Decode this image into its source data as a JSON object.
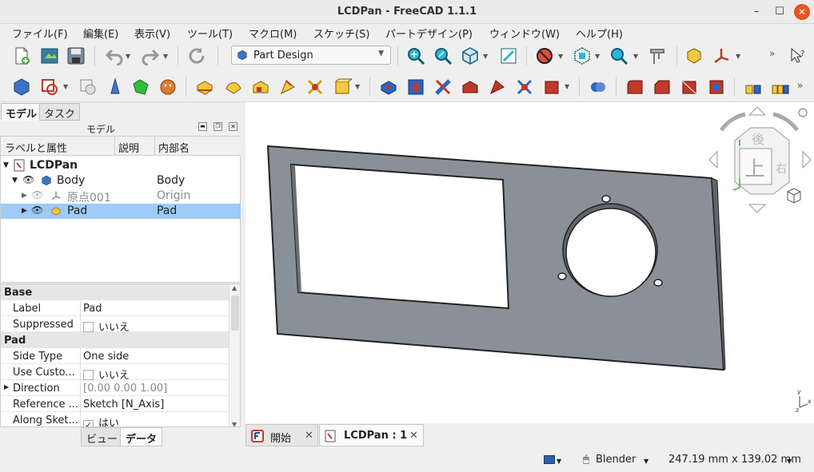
{
  "window": {
    "title": "LCDPan - FreeCAD 1.1.1",
    "minimize": "–",
    "maximize": "☐",
    "close": "✕"
  },
  "menu": [
    "ファイル(F)",
    "編集(E)",
    "表示(V)",
    "ツール(T)",
    "マクロ(M)",
    "スケッチ(S)",
    "パートデザイン(P)",
    "ウィンドウ(W)",
    "ヘルプ(H)"
  ],
  "toolbar": {
    "workbench": "Part Design",
    "overflow": "»",
    "icons": [
      "new-document-icon",
      "open-icon",
      "save-icon",
      "undo-icon",
      "redo-icon",
      "refresh-icon",
      "fit-all-icon",
      "fit-selection-icon",
      "isometric-icon",
      "std-view-icon",
      "draw-style-icon",
      "bounding-box-icon",
      "measure-icon",
      "part-icon",
      "axis-icon",
      "whats-this-icon"
    ]
  },
  "panel": {
    "tabs": [
      "モデル",
      "タスク"
    ],
    "header": "モデル",
    "columns": [
      "ラベルと属性",
      "説明",
      "内部名"
    ],
    "tree": [
      {
        "label": "LCDPan",
        "desc": "",
        "name": ""
      },
      {
        "label": "Body",
        "desc": "",
        "name": "Body"
      },
      {
        "label": "原点001",
        "desc": "",
        "name": "Origin"
      },
      {
        "label": "Pad",
        "desc": "",
        "name": "Pad"
      }
    ]
  },
  "properties": {
    "groups": [
      {
        "name": "Base",
        "rows": [
          {
            "key": "Label",
            "value": "Pad"
          },
          {
            "key": "Suppressed",
            "value": "いいえ"
          }
        ]
      },
      {
        "name": "Pad",
        "rows": [
          {
            "key": "Side Type",
            "value": "One side"
          },
          {
            "key": "Use Custo...",
            "value": "いいえ"
          },
          {
            "key": "Direction",
            "value": "[0.00 0.00 1.00]"
          },
          {
            "key": "Reference ...",
            "value": "Sketch [N_Axis]"
          },
          {
            "key": "Along Sket...",
            "value": "はい"
          }
        ]
      }
    ],
    "bottom_tabs": [
      "ビュー",
      "データ"
    ]
  },
  "navcube": {
    "face": "上",
    "back": "後",
    "right": "右"
  },
  "axes": {
    "x": "x",
    "y": "y",
    "z": "z"
  },
  "doc_tabs": [
    {
      "label": "開始"
    },
    {
      "label": "LCDPan : 1"
    }
  ],
  "status": {
    "nav_style": "Blender",
    "dimensions": "247.19 mm x 139.02 mm"
  },
  "colors": {
    "selection": "#9ecbf7",
    "part": "#8a9098",
    "accent": "#e95420"
  }
}
